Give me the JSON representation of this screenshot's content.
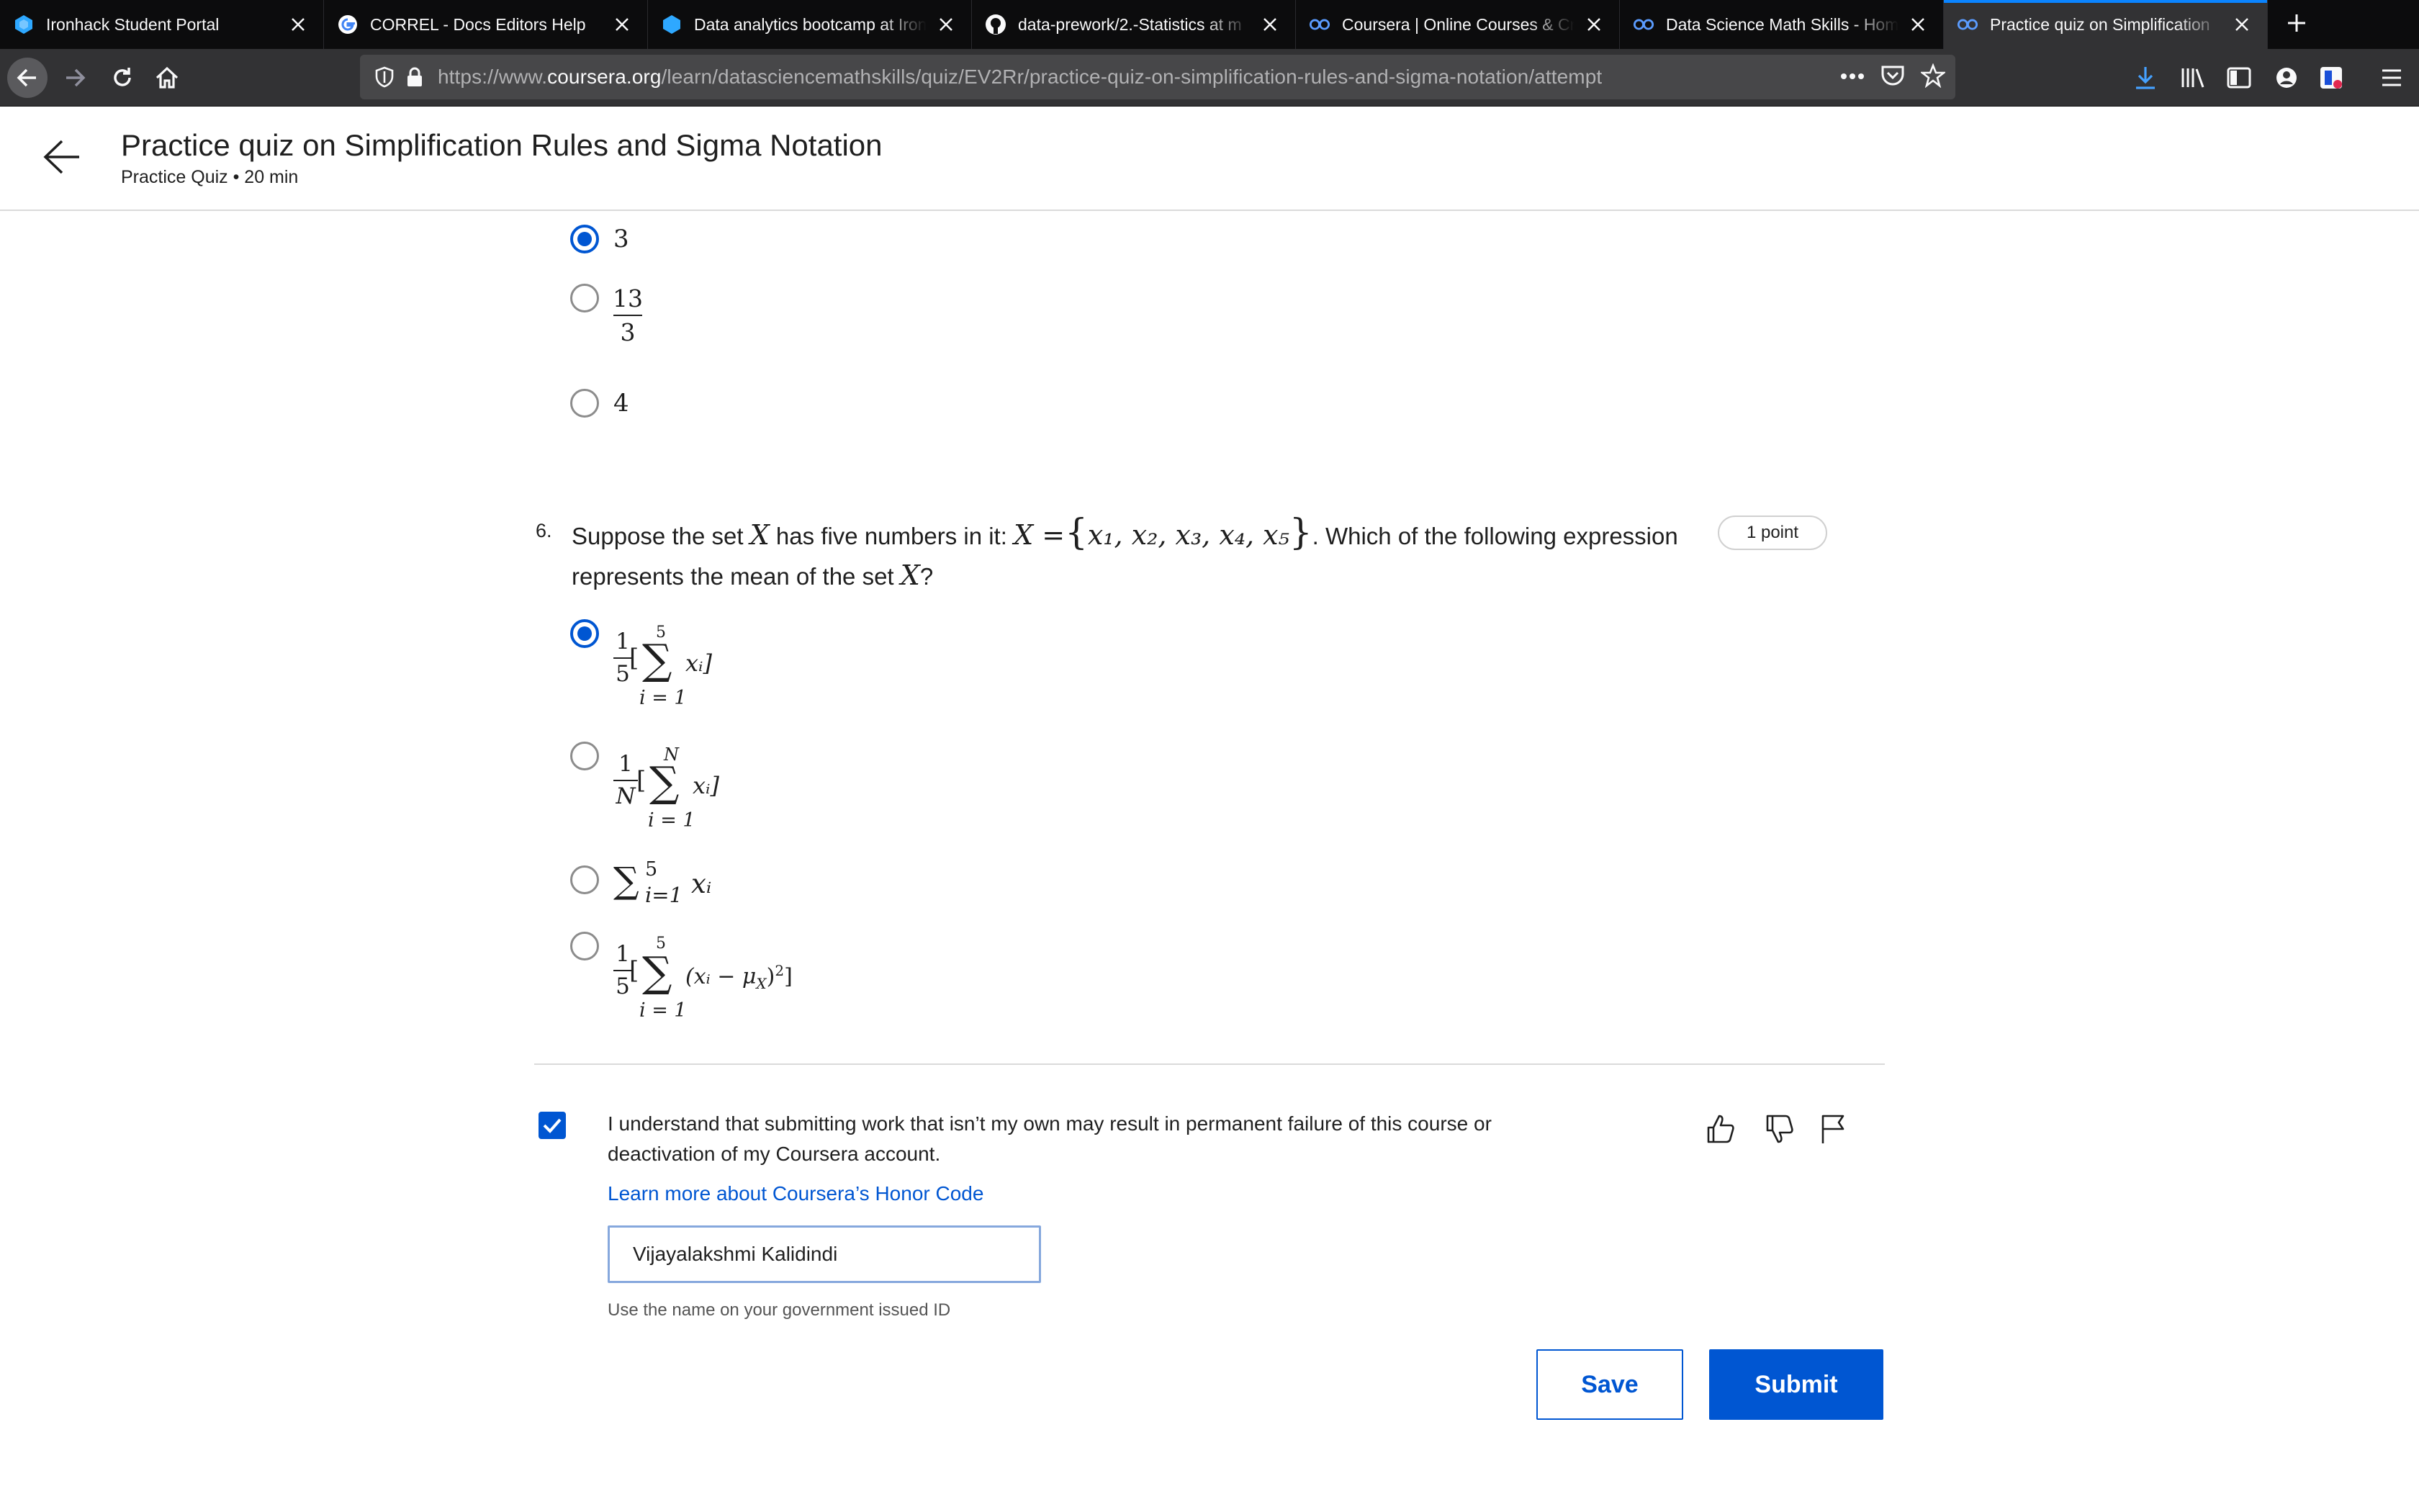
{
  "browser": {
    "tabs": [
      {
        "title": "Ironhack Student Portal",
        "favicon": "ironhack-icon"
      },
      {
        "title": "CORREL - Docs Editors Help",
        "favicon": "google-icon"
      },
      {
        "title": "Data analytics bootcamp at Iron",
        "favicon": "ironhack-icon"
      },
      {
        "title": "data-prework/2.-Statistics at m",
        "favicon": "github-icon"
      },
      {
        "title": "Coursera | Online Courses & Cr",
        "favicon": "coursera-icon"
      },
      {
        "title": "Data Science Math Skills - Hom",
        "favicon": "coursera-icon"
      },
      {
        "title": "Practice quiz on Simplification",
        "favicon": "coursera-icon",
        "active": true
      }
    ],
    "url": {
      "prefix": "https://www.",
      "host": "coursera.org",
      "path": "/learn/datasciencemathskills/quiz/EV2Rr/practice-quiz-on-simplification-rules-and-sigma-notation/attempt"
    }
  },
  "header": {
    "title": "Practice quiz on Simplification Rules and Sigma Notation",
    "subtitle": "Practice Quiz • 20 min"
  },
  "q5_options": [
    {
      "text": "3",
      "selected": true
    },
    {
      "num": "13",
      "den": "3",
      "selected": false
    },
    {
      "text": "4",
      "selected": false
    }
  ],
  "question6": {
    "number": "6.",
    "text_part1": "Suppose the set",
    "var_X": "X",
    "text_part2": "has five numbers in it:",
    "set_lhs": "X =",
    "set_open": "{",
    "set_body": "x₁, x₂, x₃, x₄, x₅",
    "set_close": "}",
    "text_part3": ". Which of the following expression",
    "text_line2": "represents the mean of the set",
    "text_end": "?",
    "points": "1 point",
    "options": [
      {
        "frac_num": "1",
        "frac_den": "5",
        "sum_top": "5",
        "sum_bottom": "i = 1",
        "body": "xᵢ]",
        "selected": true
      },
      {
        "frac_num": "1",
        "frac_den": "N",
        "sum_top": "N",
        "sum_bottom": "i = 1",
        "body": "xᵢ]",
        "selected": false
      },
      {
        "inline": "∑",
        "sup": "5",
        "sub": "i=1",
        "body": "xᵢ",
        "selected": false
      },
      {
        "frac_num": "1",
        "frac_den": "5",
        "sum_top": "5",
        "sum_bottom": "i = 1",
        "body": "(xᵢ − μ",
        "body_sub": "X",
        "body_tail": ")",
        "body_sup": "2",
        "close": "]",
        "selected": false
      }
    ]
  },
  "honor": {
    "checked": true,
    "text": "I understand that submitting work that isn’t my own may result in permanent failure of this course or deactivation of my Coursera account.",
    "link": "Learn more about Coursera’s Honor Code",
    "name_value": "Vijayalakshmi Kalidindi",
    "help": "Use the name on your government issued ID"
  },
  "actions": {
    "save": "Save",
    "submit": "Submit"
  },
  "colors": {
    "accent": "#0056d2",
    "tab_active_line": "#0a84ff",
    "chrome_dark": "#0c0c0d",
    "chrome_mid": "#323234"
  }
}
